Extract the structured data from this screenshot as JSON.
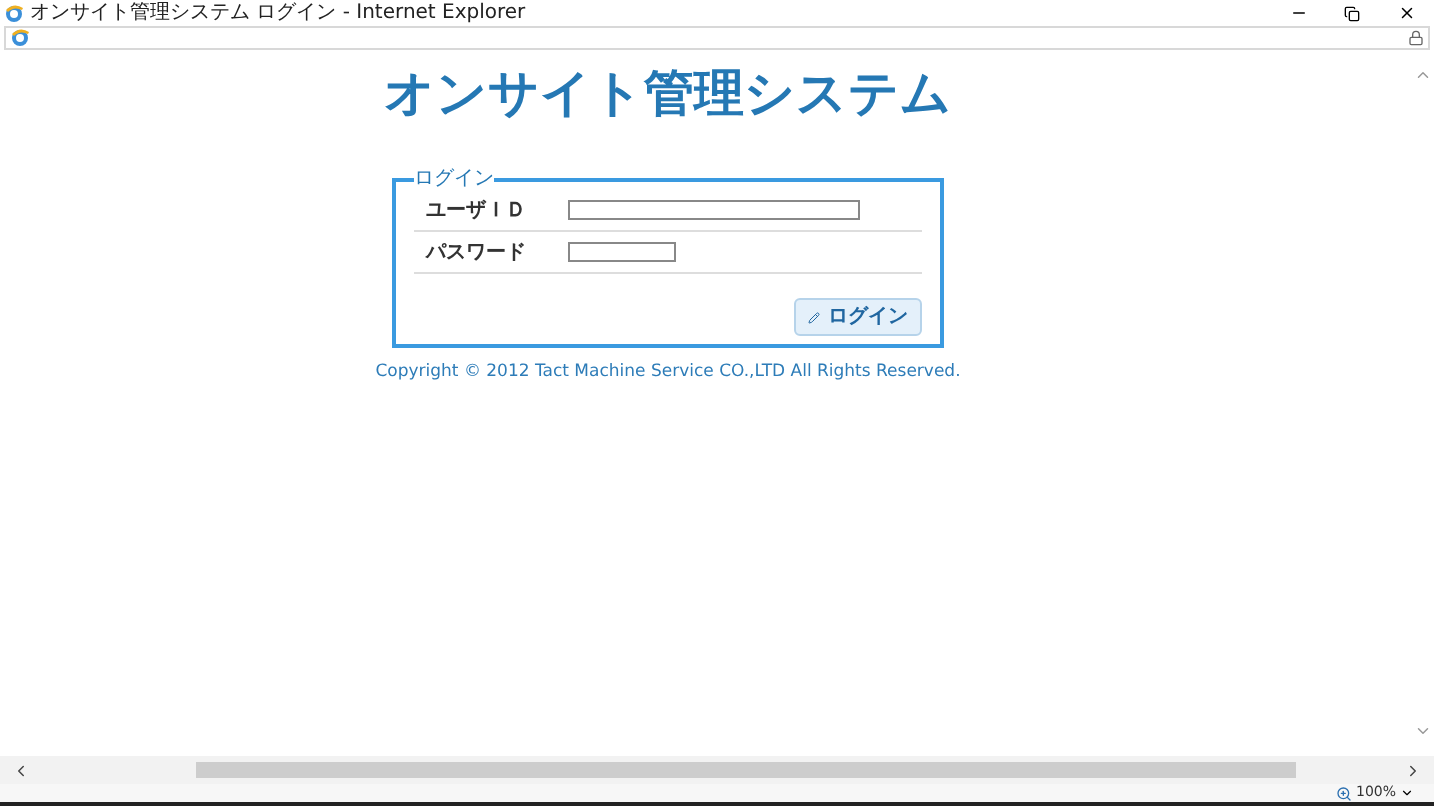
{
  "window": {
    "title": "オンサイト管理システム ログイン - Internet Explorer"
  },
  "page": {
    "heading": "オンサイト管理システム",
    "login": {
      "legend": "ログイン",
      "fields": [
        {
          "label": "ユーザＩＤ",
          "kind": "long"
        },
        {
          "label": "パスワード",
          "kind": "short"
        }
      ],
      "button": "ログイン"
    },
    "copyright": "Copyright © 2012 Tact Machine Service CO.,LTD All Rights Reserved."
  },
  "status_bar": {
    "zoom": "100%"
  }
}
